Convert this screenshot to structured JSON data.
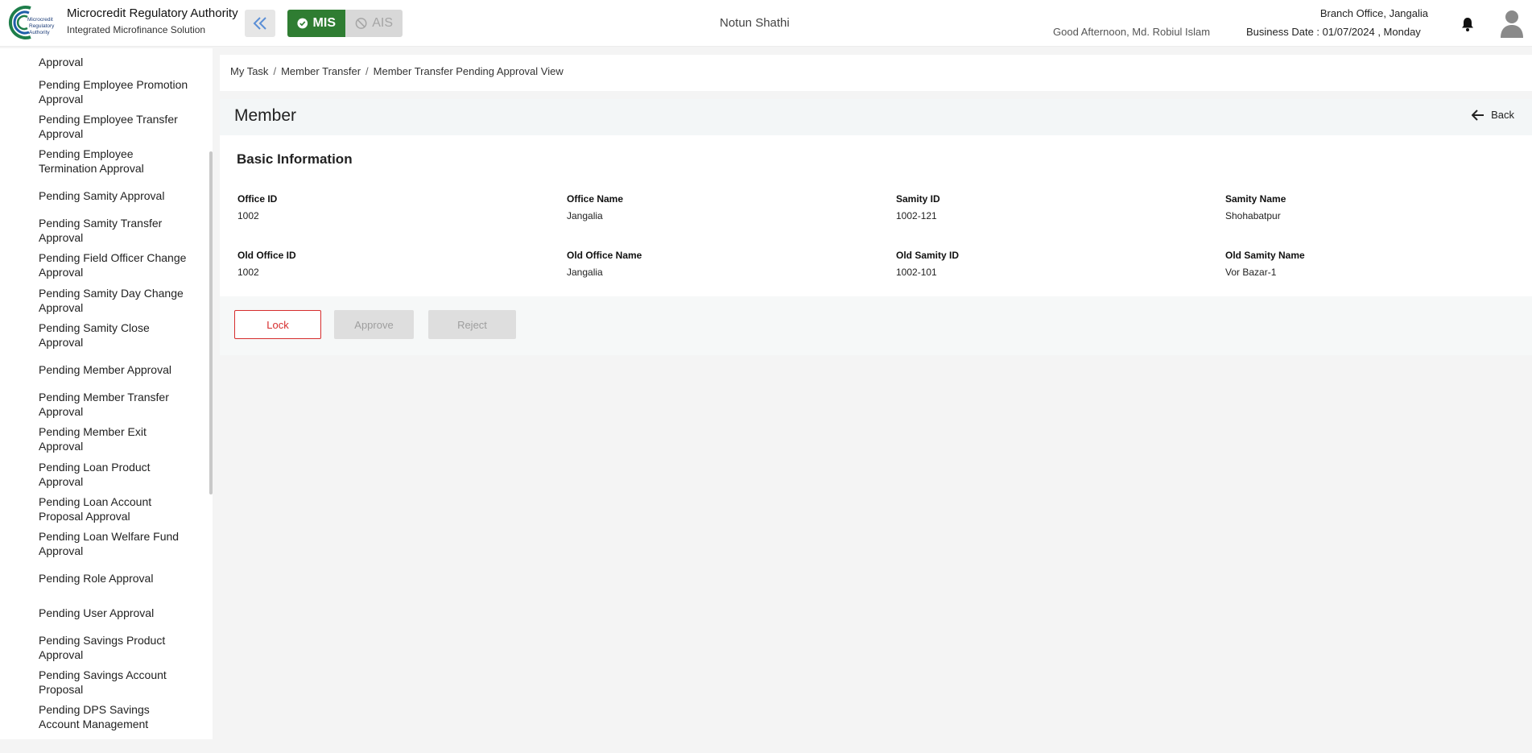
{
  "header": {
    "logo_text": [
      "Microcredit",
      "Regulatory",
      "Authority"
    ],
    "app_title": "Microcredit Regulatory Authority",
    "app_subtitle": "Integrated Microfinance Solution",
    "mode_mis": "MIS",
    "mode_ais": "AIS",
    "center_title": "Notun Shathi",
    "greeting": "Good Afternoon, Md. Robiul Islam",
    "branch": "Branch Office, Jangalia",
    "business_date": "Business Date : 01/07/2024 , Monday",
    "colors": {
      "mis_active": "#2f7d32",
      "ais_inactive": "#d8d8d8",
      "collapse_icon": "#5b8fd6"
    }
  },
  "sidebar": {
    "items": [
      {
        "label": "Approval"
      },
      {
        "label": "Pending Employee Promotion Approval"
      },
      {
        "label": "Pending Employee Transfer Approval"
      },
      {
        "label": "Pending Employee Termination Approval"
      },
      {
        "label": "Pending Samity Approval"
      },
      {
        "label": "Pending Samity Transfer Approval"
      },
      {
        "label": "Pending Field Officer Change Approval"
      },
      {
        "label": "Pending Samity Day Change Approval"
      },
      {
        "label": "Pending Samity Close Approval"
      },
      {
        "label": "Pending Member Approval"
      },
      {
        "label": "Pending Member Transfer Approval"
      },
      {
        "label": "Pending Member Exit Approval"
      },
      {
        "label": "Pending Loan Product Approval"
      },
      {
        "label": "Pending Loan Account Proposal Approval"
      },
      {
        "label": "Pending Loan Welfare Fund Approval"
      },
      {
        "label": "Pending Role Approval"
      },
      {
        "label": "Pending User Approval"
      },
      {
        "label": "Pending Savings Product Approval"
      },
      {
        "label": "Pending Savings Account Proposal"
      },
      {
        "label": "Pending DPS Savings Account Management"
      }
    ]
  },
  "breadcrumb": [
    "My Task",
    "Member Transfer",
    "Member Transfer Pending Approval View"
  ],
  "page": {
    "title": "Member",
    "back_label": "Back",
    "section_title": "Basic Information"
  },
  "fields": {
    "office_id": {
      "label": "Office ID",
      "value": "1002"
    },
    "office_name": {
      "label": "Office Name",
      "value": "Jangalia"
    },
    "samity_id": {
      "label": "Samity ID",
      "value": "1002-121"
    },
    "samity_name": {
      "label": "Samity Name",
      "value": "Shohabatpur"
    },
    "old_office_id": {
      "label": "Old Office ID",
      "value": "1002"
    },
    "old_office_name": {
      "label": "Old Office Name",
      "value": "Jangalia"
    },
    "old_samity_id": {
      "label": "Old Samity ID",
      "value": "1002-101"
    },
    "old_samity_name": {
      "label": "Old Samity Name",
      "value": "Vor Bazar-1"
    }
  },
  "actions": {
    "lock": "Lock",
    "approve": "Approve",
    "reject": "Reject"
  }
}
